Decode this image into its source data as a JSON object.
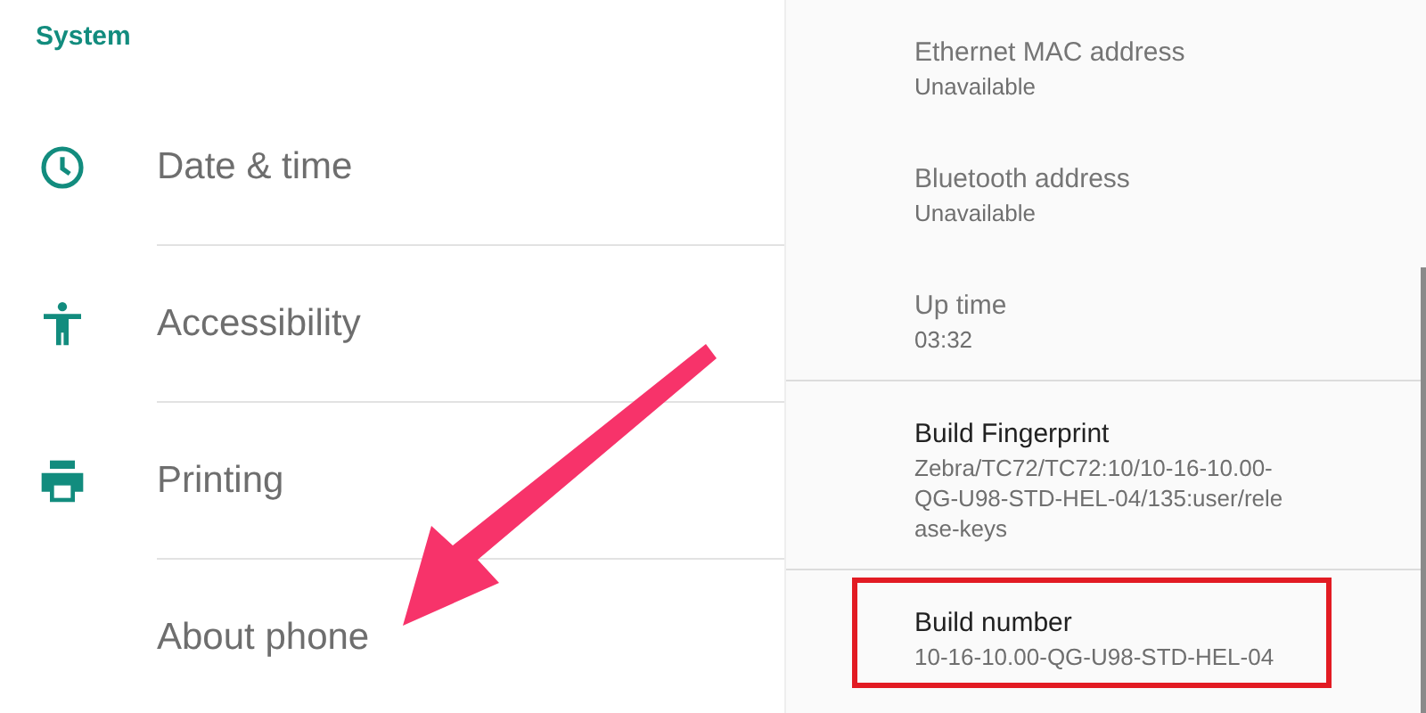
{
  "system_list": {
    "header": "System",
    "items": [
      {
        "label": "Date & time"
      },
      {
        "label": "Accessibility"
      },
      {
        "label": "Printing"
      },
      {
        "label": "About phone"
      }
    ]
  },
  "about_phone": {
    "items": [
      {
        "title": "Ethernet MAC address",
        "value": "Unavailable",
        "disabled": true,
        "highlighted": false,
        "divider_after": false
      },
      {
        "title": "Bluetooth address",
        "value": "Unavailable",
        "disabled": true,
        "highlighted": false,
        "divider_after": false
      },
      {
        "title": "Up time",
        "value": "03:32",
        "disabled": true,
        "highlighted": false,
        "divider_after": true
      },
      {
        "title": "Build Fingerprint",
        "value": "Zebra/TC72/TC72:10/10-16-10.00-QG-U98-STD-HEL-04/135:user/release-keys",
        "disabled": false,
        "highlighted": false,
        "divider_after": true
      },
      {
        "title": "Build number",
        "value": "10-16-10.00-QG-U98-STD-HEL-04",
        "disabled": false,
        "highlighted": true,
        "divider_after": false
      }
    ]
  },
  "annotations": [
    {
      "kind": "arrow"
    }
  ]
}
